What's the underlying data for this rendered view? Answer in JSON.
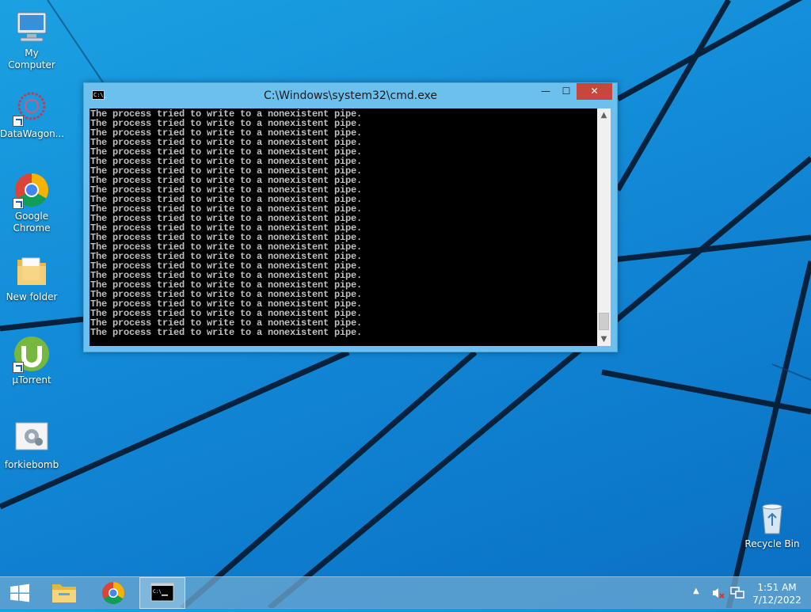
{
  "desktop": {
    "icons": [
      {
        "label": "My Computer",
        "icon": "computer-icon"
      },
      {
        "label": "DataWagon...",
        "icon": "datawagon-icon"
      },
      {
        "label": "Google Chrome",
        "icon": "chrome-icon"
      },
      {
        "label": "New folder",
        "icon": "folder-icon"
      },
      {
        "label": "µTorrent",
        "icon": "utorrent-icon"
      },
      {
        "label": "forkiebomb",
        "icon": "batch-file-icon"
      }
    ],
    "recycle_bin": {
      "label": "Recycle Bin",
      "icon": "recycle-bin-icon"
    }
  },
  "cmd_window": {
    "title": "C:\\Windows\\system32\\cmd.exe",
    "icon_text": "C:\\_",
    "buttons": {
      "minimize": "—",
      "maximize": "☐",
      "close": "✕"
    },
    "console_lines": [
      "The process tried to write to a nonexistent pipe.",
      "The process tried to write to a nonexistent pipe.",
      "The process tried to write to a nonexistent pipe.",
      "The process tried to write to a nonexistent pipe.",
      "The process tried to write to a nonexistent pipe.",
      "The process tried to write to a nonexistent pipe.",
      "The process tried to write to a nonexistent pipe.",
      "The process tried to write to a nonexistent pipe.",
      "The process tried to write to a nonexistent pipe.",
      "The process tried to write to a nonexistent pipe.",
      "The process tried to write to a nonexistent pipe.",
      "The process tried to write to a nonexistent pipe.",
      "The process tried to write to a nonexistent pipe.",
      "The process tried to write to a nonexistent pipe.",
      "The process tried to write to a nonexistent pipe.",
      "The process tried to write to a nonexistent pipe.",
      "The process tried to write to a nonexistent pipe.",
      "The process tried to write to a nonexistent pipe.",
      "The process tried to write to a nonexistent pipe.",
      "The process tried to write to a nonexistent pipe.",
      "The process tried to write to a nonexistent pipe.",
      "The process tried to write to a nonexistent pipe.",
      "The process tried to write to a nonexistent pipe.",
      "The process tried to write to a nonexistent pipe."
    ]
  },
  "taskbar": {
    "items": [
      {
        "name": "start",
        "icon": "windows-logo-icon"
      },
      {
        "name": "file-explorer",
        "icon": "file-explorer-icon"
      },
      {
        "name": "chrome",
        "icon": "chrome-icon"
      },
      {
        "name": "cmd",
        "icon": "cmd-icon",
        "active": true
      }
    ],
    "tray": {
      "arrow": "▲",
      "volume_icon": "volume-muted-icon",
      "network_icon": "network-icon"
    },
    "clock": {
      "time": "1:51 AM",
      "date": "7/12/2022"
    }
  },
  "colors": {
    "accent": "#1ba1e2",
    "close_button": "#c7463e",
    "console_text": "#c0c0c0"
  }
}
